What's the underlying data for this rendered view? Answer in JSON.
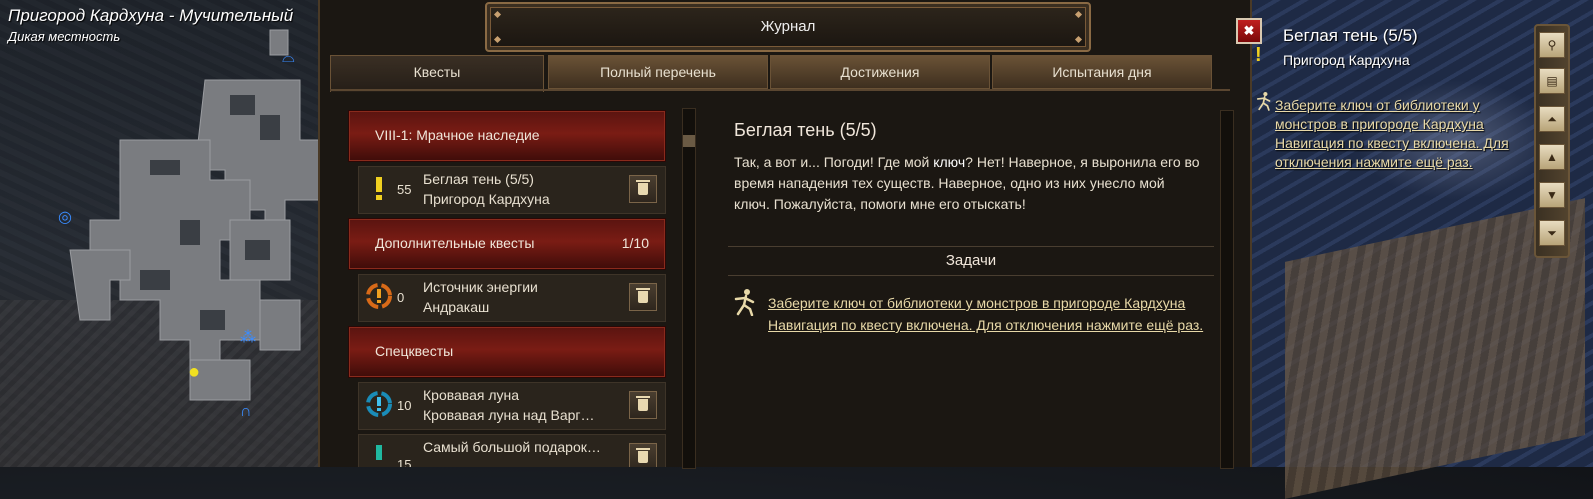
{
  "location": {
    "name": "Пригород Кардхуна - Мучительный",
    "subname": "Дикая местность"
  },
  "journal": {
    "title": "Журнал",
    "close_label": "✖",
    "tabs": [
      {
        "label": "Квесты",
        "active": true
      },
      {
        "label": "Полный перечень",
        "active": false
      },
      {
        "label": "Достижения",
        "active": false
      },
      {
        "label": "Испытания дня",
        "active": false
      }
    ],
    "list": {
      "main_category": "VIII-1: Мрачное наследие",
      "main_quest": {
        "level": "55",
        "title": "Беглая тень (5/5)",
        "location": "Пригород Кардхуна"
      },
      "extra_category": {
        "label": "Дополнительные квесты",
        "count": "1/10"
      },
      "extra_quest": {
        "level": "0",
        "title": "Источник энергии",
        "location": "Андракаш"
      },
      "special_category": "Спецквесты",
      "special_quests": [
        {
          "level": "10",
          "title": "Кровавая луна",
          "location": "Кровавая луна над Варг…"
        },
        {
          "level": "15",
          "title": "Самый большой подарок…",
          "location": ""
        }
      ]
    },
    "detail": {
      "title": "Беглая тень (5/5)",
      "text_before": "Так, а вот и... Погоди! Где мой ",
      "text_bold": "ключ",
      "text_after": "? Нет! Наверное, я выронила его во время нападения тех существ. Наверное, одно из них унесло мой ключ. Пожалуйста, помоги мне его отыскать!",
      "tasks_header": "Задачи",
      "task_objective": "Заберите ключ от библиотеки у монстров в пригороде Кардхуна",
      "task_nav": "Навигация по квесту включена. Для отключения нажмите ещё раз."
    }
  },
  "tracker": {
    "title": "Беглая тень (5/5)",
    "location": "Пригород Кардхуна",
    "objective": "Заберите ключ от библиотеки у монстров в пригороде Кардхуна",
    "nav": "Навигация по квесту включена. Для отключения нажмите ещё раз."
  },
  "sidebar_buttons": [
    "search-icon",
    "scroll-icon",
    "double-up-icon",
    "up-icon",
    "down-icon",
    "double-down-icon"
  ],
  "colors": {
    "accent_gold": "#e8d9a8",
    "category_red": "#7a1c14",
    "quest_yellow": "#f0d020"
  }
}
